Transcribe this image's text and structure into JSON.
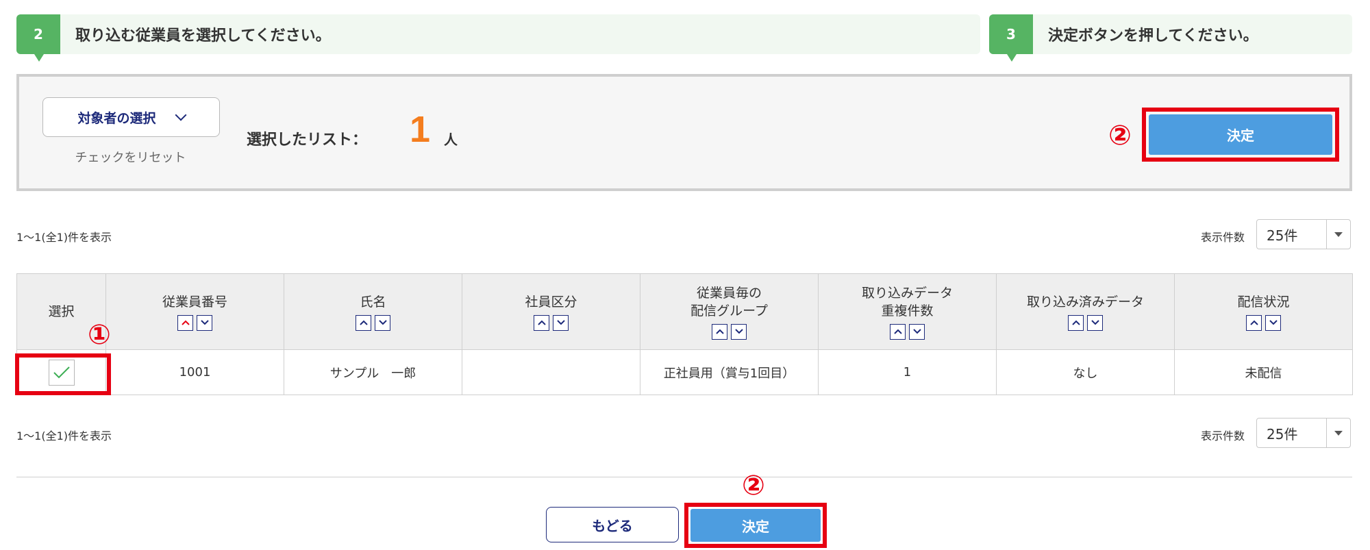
{
  "steps": [
    {
      "number": "2",
      "text": "取り込む従業員を選択してください。"
    },
    {
      "number": "3",
      "text": "決定ボタンを押してください。"
    }
  ],
  "selection": {
    "dropdown_label": "対象者の選択",
    "reset_label": "チェックをリセット",
    "list_label": "選択したリスト：",
    "count": "1",
    "unit": "人",
    "confirm_label": "決定"
  },
  "annotations": {
    "marker_1": "①",
    "marker_2": "②"
  },
  "paging": {
    "info": "1～1(全1)件を表示",
    "per_page_label": "表示件数",
    "per_page_value": "25件"
  },
  "table": {
    "headers": [
      {
        "line1": "選択",
        "line2": ""
      },
      {
        "line1": "従業員番号",
        "line2": ""
      },
      {
        "line1": "氏名",
        "line2": ""
      },
      {
        "line1": "社員区分",
        "line2": ""
      },
      {
        "line1": "従業員毎の",
        "line2": "配信グループ"
      },
      {
        "line1": "取り込みデータ",
        "line2": "重複件数"
      },
      {
        "line1": "取り込み済みデータ",
        "line2": ""
      },
      {
        "line1": "配信状況",
        "line2": ""
      }
    ],
    "rows": [
      {
        "checked": true,
        "employee_no": "1001",
        "name": "サンプル　一郎",
        "category": "",
        "group": "正社員用（賞与1回目）",
        "duplicates": "1",
        "imported": "なし",
        "status": "未配信"
      }
    ]
  },
  "footer": {
    "back_label": "もどる",
    "confirm_label": "決定"
  },
  "colors": {
    "step_green": "#56b463",
    "accent_blue": "#4d9de0",
    "navy": "#1d2a7a",
    "annotation_red": "#e60012",
    "count_orange": "#f47d1e"
  },
  "icons": {
    "sort_up": "chevron-up-icon",
    "sort_down": "chevron-down-icon",
    "check": "check-icon"
  }
}
